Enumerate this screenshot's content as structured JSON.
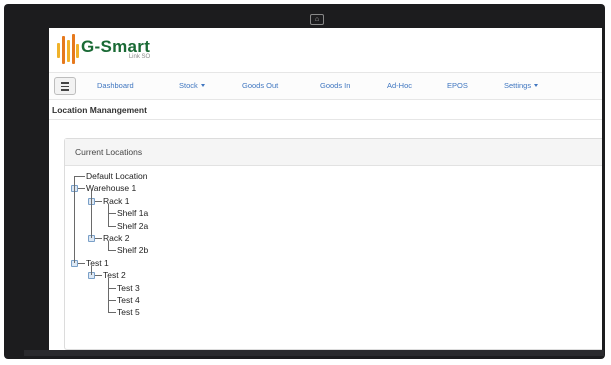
{
  "app": {
    "brand_name": "G-Smart",
    "brand_tagline": "Link SO"
  },
  "nav": {
    "items": [
      {
        "label": "Dashboard",
        "has_dropdown": false
      },
      {
        "label": "Stock",
        "has_dropdown": true
      },
      {
        "label": "Goods Out",
        "has_dropdown": false
      },
      {
        "label": "Goods In",
        "has_dropdown": false
      },
      {
        "label": "Ad-Hoc",
        "has_dropdown": false
      },
      {
        "label": "EPOS",
        "has_dropdown": false
      },
      {
        "label": "Settings",
        "has_dropdown": true
      }
    ]
  },
  "page": {
    "title": "Location Manangement"
  },
  "panel": {
    "heading": "Current Locations"
  },
  "tree": {
    "nodes": [
      {
        "label": "Default Location",
        "depth": 0,
        "expandable": false
      },
      {
        "label": "Warehouse 1",
        "depth": 0,
        "expandable": true
      },
      {
        "label": "Rack 1",
        "depth": 1,
        "expandable": true
      },
      {
        "label": "Shelf 1a",
        "depth": 2,
        "expandable": false
      },
      {
        "label": "Shelf 2a",
        "depth": 2,
        "expandable": false
      },
      {
        "label": "Rack 2",
        "depth": 1,
        "expandable": true
      },
      {
        "label": "Shelf 2b",
        "depth": 2,
        "expandable": false
      },
      {
        "label": "Test 1",
        "depth": 0,
        "expandable": true
      },
      {
        "label": "Test 2",
        "depth": 1,
        "expandable": true
      },
      {
        "label": "Test 3",
        "depth": 2,
        "expandable": false
      },
      {
        "label": "Test 4",
        "depth": 2,
        "expandable": false
      },
      {
        "label": "Test 5",
        "depth": 2,
        "expandable": false
      }
    ]
  },
  "colors": {
    "brand_green": "#1a6a35",
    "nav_link": "#3f76c0",
    "monitor_frame": "#1c1c1e"
  },
  "icons": {
    "menu": "hamburger-icon",
    "monitor_logo": "monitor-brand-icon",
    "dropdown": "caret-down-icon",
    "tree_expander": "tree-expander-icon"
  }
}
